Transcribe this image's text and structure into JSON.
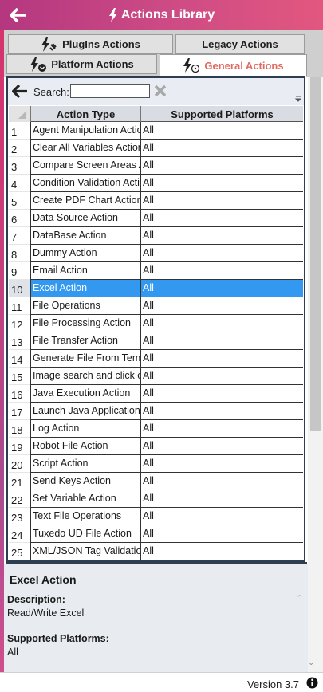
{
  "window": {
    "title": "Actions Library"
  },
  "tabs": [
    {
      "label": "PlugIns Actions",
      "active": false
    },
    {
      "label": "Legacy Actions",
      "active": false
    },
    {
      "label": "Platform Actions",
      "active": false
    },
    {
      "label": "General Actions",
      "active": true
    }
  ],
  "search": {
    "label": "Search:",
    "value": ""
  },
  "grid": {
    "columns": [
      "Action Type",
      "Supported Platforms"
    ],
    "selected_index": 10,
    "rows": [
      {
        "num": "1",
        "type": "Agent Manipulation Action",
        "platforms": "All"
      },
      {
        "num": "2",
        "type": "Clear All Variables Action",
        "platforms": "All"
      },
      {
        "num": "3",
        "type": "Compare Screen Areas Action",
        "platforms": "All"
      },
      {
        "num": "4",
        "type": "Condition Validation Action",
        "platforms": "All"
      },
      {
        "num": "5",
        "type": "Create PDF Chart Action",
        "platforms": "All"
      },
      {
        "num": "6",
        "type": "Data Source Action",
        "platforms": "All"
      },
      {
        "num": "7",
        "type": "DataBase Action",
        "platforms": "All"
      },
      {
        "num": "8",
        "type": "Dummy Action",
        "platforms": "All"
      },
      {
        "num": "9",
        "type": "Email Action",
        "platforms": "All"
      },
      {
        "num": "10",
        "type": "Excel Action",
        "platforms": "All"
      },
      {
        "num": "11",
        "type": "File Operations",
        "platforms": "All"
      },
      {
        "num": "12",
        "type": "File Processing Action",
        "platforms": "All"
      },
      {
        "num": "13",
        "type": "File Transfer Action",
        "platforms": "All"
      },
      {
        "num": "14",
        "type": "Generate File From Template",
        "platforms": "All"
      },
      {
        "num": "15",
        "type": "Image search and click on",
        "platforms": "All"
      },
      {
        "num": "16",
        "type": "Java Execution Action",
        "platforms": "All"
      },
      {
        "num": "17",
        "type": "Launch Java Application",
        "platforms": "All"
      },
      {
        "num": "18",
        "type": "Log Action",
        "platforms": "All"
      },
      {
        "num": "19",
        "type": "Robot File Action",
        "platforms": "All"
      },
      {
        "num": "20",
        "type": "Script Action",
        "platforms": "All"
      },
      {
        "num": "21",
        "type": "Send Keys Action",
        "platforms": "All"
      },
      {
        "num": "22",
        "type": "Set Variable Action",
        "platforms": "All"
      },
      {
        "num": "23",
        "type": "Text File Operations",
        "platforms": "All"
      },
      {
        "num": "24",
        "type": "Tuxedo UD File Action",
        "platforms": "All"
      },
      {
        "num": "25",
        "type": "XML/JSON Tag Validation",
        "platforms": "All"
      }
    ]
  },
  "details": {
    "title": "Excel Action",
    "description_label": "Description:",
    "description": "Read/Write Excel",
    "platforms_label": "Supported Platforms:",
    "platforms": "All"
  },
  "footer": {
    "version": "Version 3.7"
  },
  "colors": {
    "title_gradient_start": "#b4377f",
    "title_gradient_end": "#e2577f",
    "active_tab_text": "#e06a62",
    "selection": "#3399f0"
  },
  "icons": {
    "back": "arrow-left-icon",
    "title": "lightning-icon",
    "clear": "x-icon",
    "info": "info-circle-icon"
  }
}
